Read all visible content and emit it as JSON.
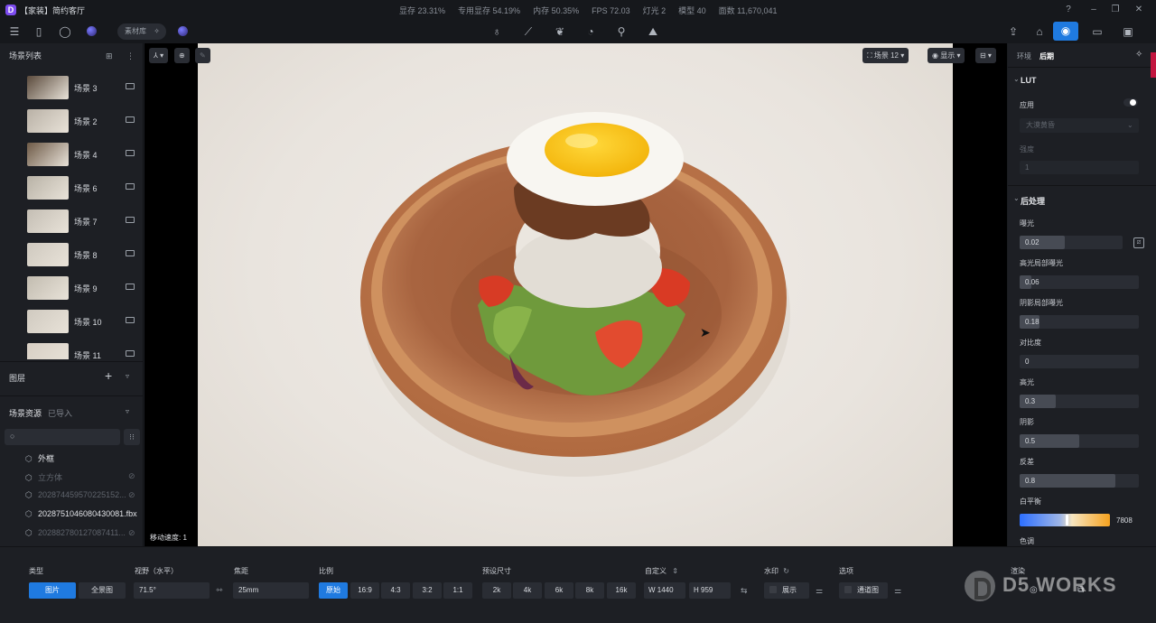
{
  "titlebar": {
    "title": "【家装】简约客厅",
    "stats": [
      "显存 23.31%",
      "专用显存 54.19%",
      "内存 50.35%",
      "FPS 72.03",
      "灯光 2",
      "模型 40",
      "面数 11,670,041"
    ]
  },
  "toolbar": {
    "library_label": "素材库"
  },
  "left": {
    "scene_list_title": "场景列表",
    "scenes": [
      {
        "label": "场景 3",
        "thumb": "#5a4a3c"
      },
      {
        "label": "场景 2",
        "thumb": "#b9b1a6"
      },
      {
        "label": "场景 4",
        "thumb": "#6e5a47"
      },
      {
        "label": "场景 6",
        "thumb": "#b8b2a6"
      },
      {
        "label": "场景 7",
        "thumb": "#c4beb4"
      },
      {
        "label": "场景 8",
        "thumb": "#cfc9bf"
      },
      {
        "label": "场景 9",
        "thumb": "#c2bcb0"
      },
      {
        "label": "场景 10",
        "thumb": "#d0cac0"
      },
      {
        "label": "场景 11",
        "thumb": "#d8cfc4"
      }
    ],
    "layers_title": "图层",
    "assets_tab": "场景资源",
    "imported_tab": "已导入",
    "assets": [
      {
        "label": "外框",
        "enabled": true
      },
      {
        "label": "立方体",
        "enabled": false
      },
      {
        "label": "202874459570225152...",
        "enabled": false
      },
      {
        "label": "202875104608043008​1.fbx",
        "enabled": true
      },
      {
        "label": "202882780127087411...",
        "enabled": false
      }
    ]
  },
  "viewport": {
    "scene_select": "场景 12",
    "display_label": "显示",
    "speed_label": "移动速度: 1"
  },
  "right": {
    "tab_env": "环境",
    "tab_post": "后期",
    "lut_title": "LUT",
    "apply_label": "应用",
    "lut_preset": "大漠黄昏",
    "strength_label": "强度",
    "strength_value": "1",
    "post_title": "后处理",
    "params": [
      {
        "label": "曝光",
        "value": "0.02",
        "fill": 0.44
      },
      {
        "label": "高光局部曝光",
        "value": "0.06",
        "fill": 0.1
      },
      {
        "label": "阴影局部曝光",
        "value": "0.18",
        "fill": 0.17
      },
      {
        "label": "对比度",
        "value": "0",
        "fill": 0
      },
      {
        "label": "高光",
        "value": "0.3",
        "fill": 0.3
      },
      {
        "label": "阴影",
        "value": "0.5",
        "fill": 0.5
      },
      {
        "label": "反差",
        "value": "0.8",
        "fill": 0.8
      }
    ],
    "wb_label": "白平衡",
    "wb_value": "7808",
    "tint_label": "色调"
  },
  "bottom": {
    "type_label": "类型",
    "type_photo": "图片",
    "type_pano": "全景图",
    "fov_label": "视野（水平）",
    "fov_value": "71.5°",
    "focal_label": "焦距",
    "focal_value": "25mm",
    "ratio_label": "比例",
    "ratios": [
      "原始",
      "16:9",
      "4:3",
      "3:2",
      "1:1"
    ],
    "preset_label": "预设尺寸",
    "presets": [
      "2k",
      "4k",
      "6k",
      "8k",
      "16k"
    ],
    "custom_label": "自定义",
    "width": "W 1440",
    "height": "H 959",
    "watermark_label": "水印",
    "watermark_show": "展示",
    "options_label": "选项",
    "channel_label": "通道图",
    "render_label": "渲染"
  },
  "watermark": "D5 WORKS",
  "colors": {
    "accent": "#1f7ae0",
    "panel": "#1d1f24",
    "background": "#16181c"
  }
}
